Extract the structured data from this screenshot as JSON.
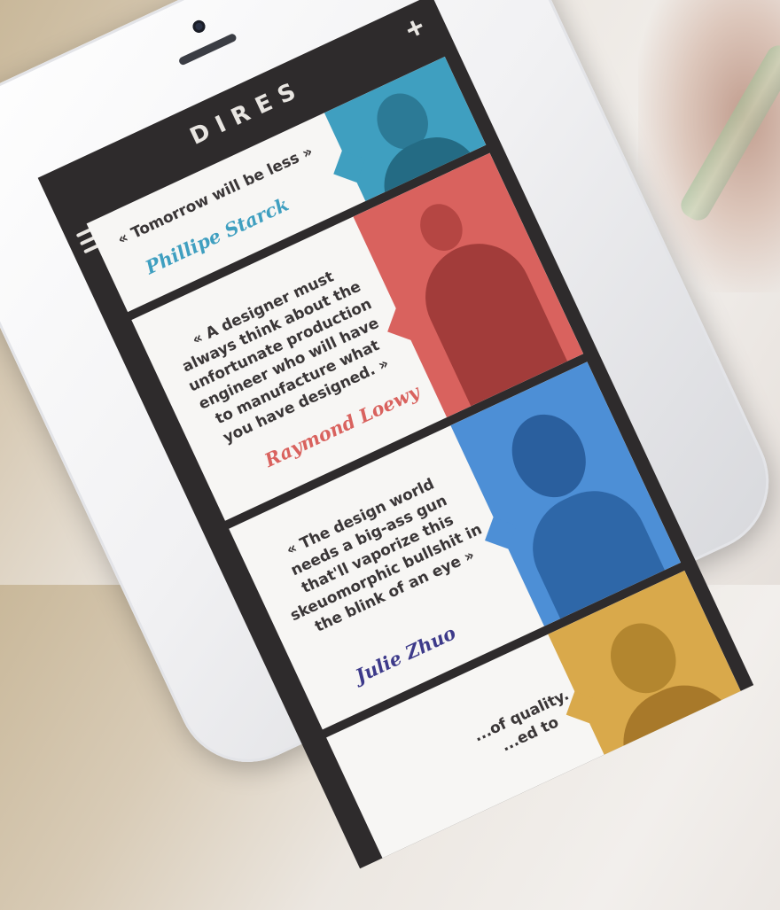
{
  "app": {
    "title": "DIRES"
  },
  "header": {
    "add_label": "+"
  },
  "quotes": [
    {
      "text": "« Tomorrow will be less »",
      "author": "Phillipe Starck",
      "author_color": "#3f9fc0",
      "photo_tint": "#3f9fc0"
    },
    {
      "text": "« A designer must always think about the unfortunate production engineer who will have to manufacture what you have designed. »",
      "author": "Raymond Loewy",
      "author_color": "#d9625e",
      "photo_tint": "#d9625e"
    },
    {
      "text": "« The design world needs a big-ass gun that'll vaporize this skeuomorphic bullshit in the blink of an eye »",
      "author": "Julie Zhuo",
      "author_color": "#3d3a8a",
      "photo_tint": "#4d8fd6"
    },
    {
      "text": "...of quality. ...ed to",
      "author": "",
      "author_color": "#d9a94b",
      "photo_tint": "#d9a94b"
    }
  ]
}
